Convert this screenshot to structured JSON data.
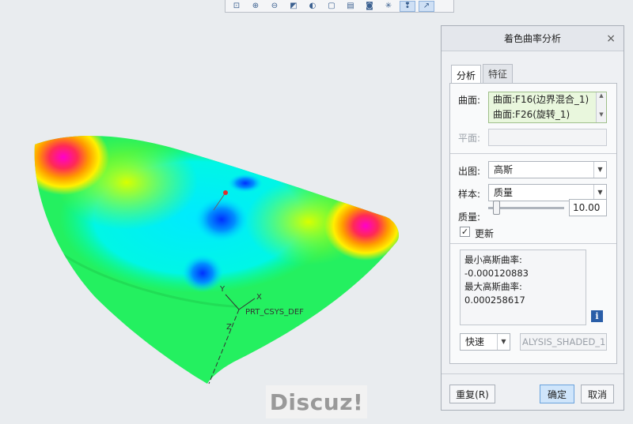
{
  "toolbar": {
    "icons": [
      "zoom-fit-icon",
      "zoom-in-icon",
      "zoom-out-icon",
      "repaint-icon",
      "display-style-icon",
      "saved-views-icon",
      "layers-icon",
      "camera-icon",
      "datum-display-icon",
      "annotation-display-icon",
      "spin-center-icon"
    ]
  },
  "viewport": {
    "csys_label": "PRT_CSYS_DEF",
    "axis_x": "X",
    "axis_y": "Y",
    "axis_z": "Z",
    "watermark": "Discuz!"
  },
  "dialog": {
    "title": "着色曲率分析",
    "close": "×",
    "tabs": [
      {
        "label": "分析",
        "active": true
      },
      {
        "label": "特征",
        "active": false
      }
    ],
    "surface_label": "曲面:",
    "surfaces": [
      "曲面:F16(边界混合_1)",
      "曲面:F26(旋转_1)"
    ],
    "plane_label": "平面:",
    "plane_value": "",
    "output_label": "出图:",
    "output_value": "高斯",
    "sample_label": "样本:",
    "sample_value": "质量",
    "quality_label": "质量:",
    "quality_value": "10.00",
    "update_label": "更新",
    "update_checked": true,
    "results": {
      "min_label": "最小高斯曲率:",
      "min_value": "-0.000120883",
      "max_label": "最大高斯曲率:",
      "max_value": "0.000258617"
    },
    "mode_value": "快速",
    "analysis_name": "ALYSIS_SHADED_1",
    "reset_label": "重复(R)",
    "ok_label": "确定",
    "cancel_label": "取消"
  },
  "colors": {
    "accent_button": "#cfe5fb",
    "surface_list_bg": "#e9f7dd"
  }
}
